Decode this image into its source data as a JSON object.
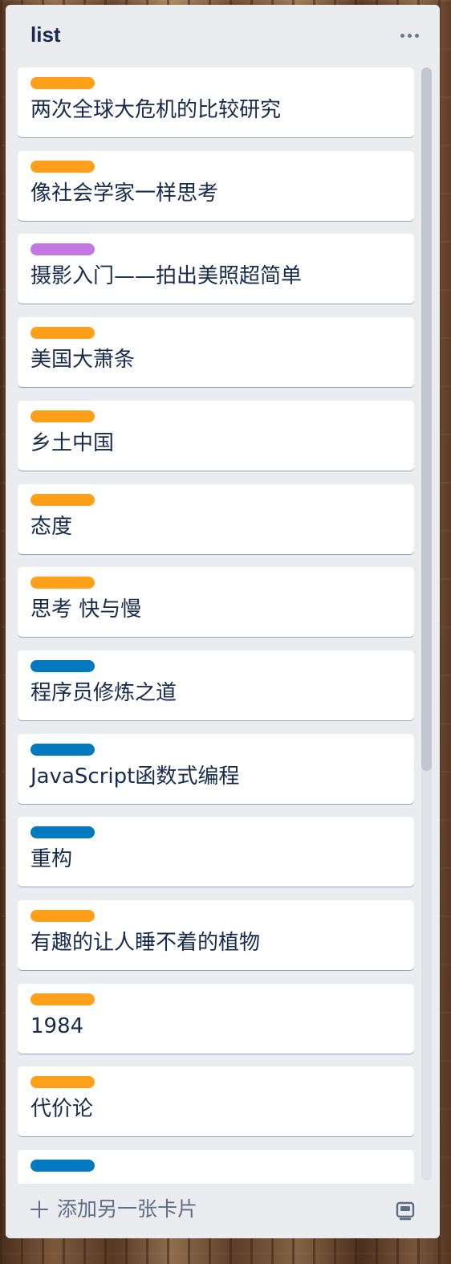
{
  "list": {
    "title": "list",
    "menu_icon": "more-horizontal-icon"
  },
  "label_colors": {
    "orange": "#ff9f1a",
    "purple": "#c377e0",
    "blue": "#0079bf"
  },
  "cards": [
    {
      "label_color": "#ff9f1a",
      "title": "两次全球大危机的比较研究"
    },
    {
      "label_color": "#ff9f1a",
      "title": "像社会学家一样思考"
    },
    {
      "label_color": "#c377e0",
      "title": "摄影入门——拍出美照超简单"
    },
    {
      "label_color": "#ff9f1a",
      "title": "美国大萧条"
    },
    {
      "label_color": "#ff9f1a",
      "title": "乡土中国"
    },
    {
      "label_color": "#ff9f1a",
      "title": "态度"
    },
    {
      "label_color": "#ff9f1a",
      "title": "思考 快与慢"
    },
    {
      "label_color": "#0079bf",
      "title": "程序员修炼之道"
    },
    {
      "label_color": "#0079bf",
      "title": "JavaScript函数式编程"
    },
    {
      "label_color": "#0079bf",
      "title": "重构"
    },
    {
      "label_color": "#ff9f1a",
      "title": "有趣的让人睡不着的植物"
    },
    {
      "label_color": "#ff9f1a",
      "title": "1984"
    },
    {
      "label_color": "#ff9f1a",
      "title": "代价论"
    },
    {
      "label_color": "#0079bf",
      "title": ""
    }
  ],
  "footer": {
    "add_card_label": "添加另一张卡片",
    "add_icon": "plus-icon",
    "template_icon": "card-template-icon"
  }
}
